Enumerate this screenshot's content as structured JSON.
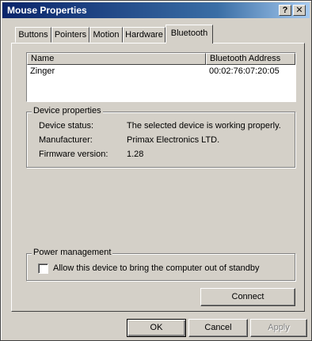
{
  "window": {
    "title": "Mouse Properties",
    "help_label": "?",
    "close_label": "✕"
  },
  "tabs": [
    {
      "label": "Buttons"
    },
    {
      "label": "Pointers"
    },
    {
      "label": "Motion"
    },
    {
      "label": "Hardware"
    },
    {
      "label": "Bluetooth"
    }
  ],
  "active_tab": "Bluetooth",
  "device_list": {
    "columns": [
      "Name",
      "Bluetooth Address"
    ],
    "rows": [
      {
        "name": "Zinger",
        "address": "00:02:76:07:20:05"
      }
    ]
  },
  "device_properties": {
    "title": "Device properties",
    "status_label": "Device status:",
    "status_value": "The selected device is working properly.",
    "manufacturer_label": "Manufacturer:",
    "manufacturer_value": "Primax Electronics LTD.",
    "firmware_label": "Firmware version:",
    "firmware_value": "1.28"
  },
  "power_management": {
    "title": "Power management",
    "standby_label": "Allow this device to bring the computer out of standby",
    "standby_checked": false
  },
  "buttons": {
    "connect": "Connect",
    "ok": "OK",
    "cancel": "Cancel",
    "apply": "Apply"
  }
}
